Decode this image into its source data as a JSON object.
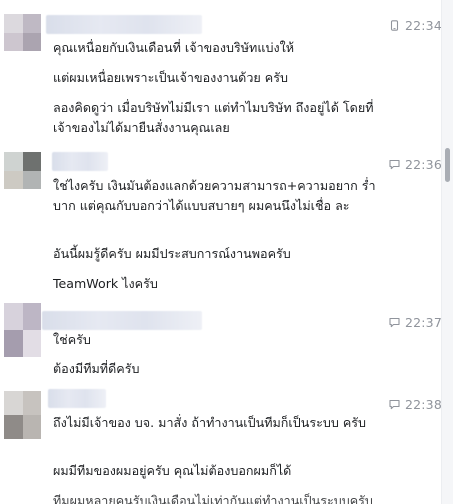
{
  "comments": [
    {
      "time": "22:34",
      "avatar_colors": [
        "#dcd9de",
        "#bfb9c4",
        "#cdc6cf",
        "#aba4b0"
      ],
      "messages": [
        "คุณเหนื่อยกับเงินเดือนที่ เจ้าของบริษัทแบ่งให้",
        "แต่ผมเหนื่อยเพราะเป็นเจ้าของงานด้วย ครับ",
        "ลองคิดดูว่า เมื่อบริษัทไม่มีเรา แต่ทำไมบริษัท ถึงอยู่ได้ โดยที่เจ้าของไม่ได้มายืนสั่งงานคุณเลย"
      ]
    },
    {
      "time": "22:36",
      "avatar_colors": [
        "#cfd3d1",
        "#6e716f",
        "#cdcac3",
        "#b1b4b4"
      ],
      "messages": [
        "ใช่ไงครับ เงินมันต้องแลกด้วยความสามารถ+ความอยาก ร่ำบาก แต่คุณกับบอกว่าได้แบบสบายๆ ผมคนนึงไม่เชื่อ ละ",
        "อันนี้ผมรู้ดีครับ ผมมีประสบการณ์งานพอครับ",
        "TeamWork ไงครับ"
      ]
    },
    {
      "time": "22:37",
      "avatar_colors": [
        "#d7d2dc",
        "#bdb6c5",
        "#a59dae",
        "#e2dde5"
      ],
      "messages": [
        "ใช่ครับ",
        "ต้องมีทีมที่ดีครับ"
      ]
    },
    {
      "time": "22:38",
      "avatar_colors": [
        "#d8d6d4",
        "#c7c3bf",
        "#8f8b88",
        "#b9b5b1"
      ],
      "messages": [
        "ถึงไม่มีเจ้าของ บจ. มาสั่ง ถ้าทำงานเป็นทีมก็เป็นระบบ ครับ",
        "ผมมีทีมของผมอยู่ครับ คุณไม่ต้องบอกผมก็ได้",
        "ทีมผมหลายคนรับเงินเดือนไม่เท่ากันแต่ทำงานเป็นระบบครับ"
      ]
    }
  ],
  "icons": {
    "first": "phone-icon",
    "others": "comment-bubble-icon"
  },
  "colors": {
    "timestamp": "#90949c",
    "text": "#1c1e21",
    "name_blur": "#dde1ec"
  }
}
